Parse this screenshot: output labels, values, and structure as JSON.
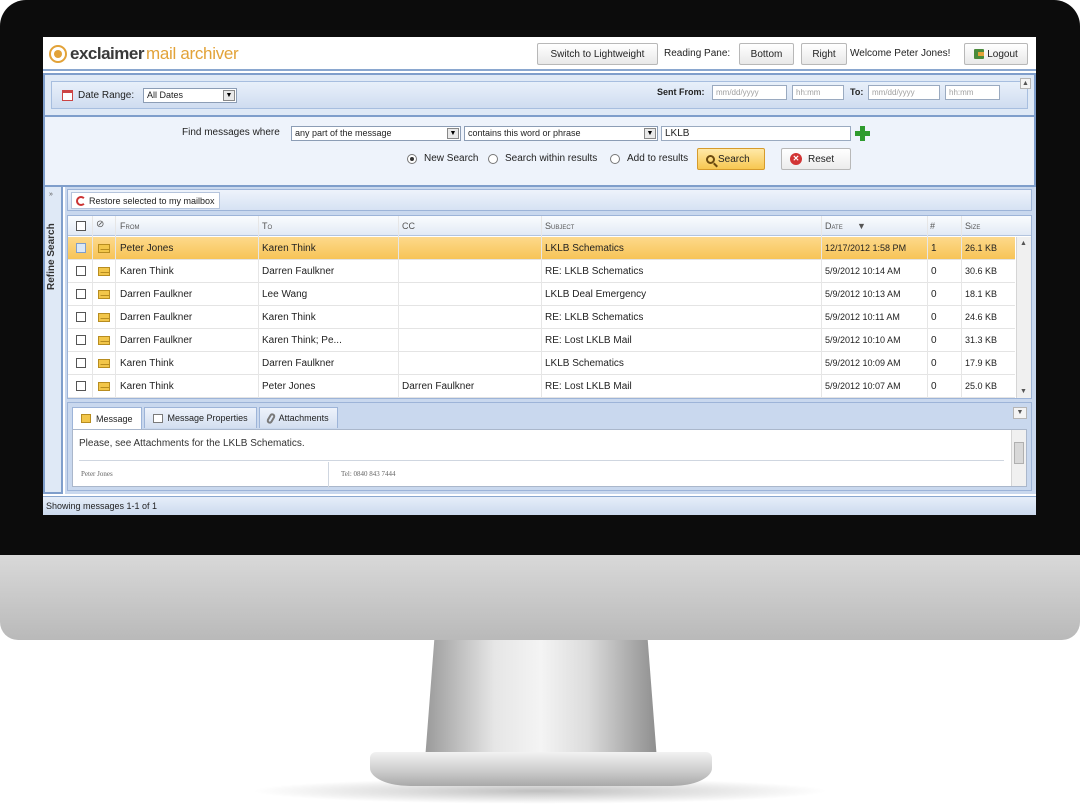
{
  "app": {
    "brand": "exclaimer",
    "product": "mail archiver"
  },
  "header": {
    "switch_label": "Switch to Lightweight",
    "reading_pane_label": "Reading Pane:",
    "bottom_label": "Bottom",
    "right_label": "Right",
    "welcome": "Welcome Peter Jones!",
    "logout_label": "Logout"
  },
  "filter": {
    "date_range_label": "Date Range:",
    "date_range_value": "All Dates",
    "sent_from_label": "Sent From:",
    "sent_from_date_placeholder": "mm/dd/yyyy",
    "sent_from_time_placeholder": "hh:mm",
    "to_label": "To:",
    "to_date_placeholder": "mm/dd/yyyy",
    "to_time_placeholder": "hh:mm"
  },
  "search": {
    "find_label": "Find messages where",
    "field_value": "any part of the message",
    "operator_value": "contains this word or phrase",
    "term_value": "LKLB",
    "radio_new": "New Search",
    "radio_within": "Search within results",
    "radio_add": "Add to results",
    "search_button": "Search",
    "reset_button": "Reset"
  },
  "sidebar": {
    "refine_label": "Refine Search"
  },
  "toolbar": {
    "restore_label": "Restore selected to my mailbox"
  },
  "grid": {
    "columns": {
      "from": "From",
      "to": "To",
      "cc": "CC",
      "subject": "Subject",
      "date": "Date",
      "count": "#",
      "size": "Size"
    },
    "rows": [
      {
        "from": "Peter Jones",
        "to": "Karen Think",
        "cc": "",
        "subject": "LKLB Schematics",
        "date": "12/17/2012 1:58 PM",
        "count": "1",
        "size": "26.1 KB"
      },
      {
        "from": "Karen Think",
        "to": "Darren Faulkner",
        "cc": "",
        "subject": "RE: LKLB Schematics",
        "date": "5/9/2012 10:14 AM",
        "count": "0",
        "size": "30.6 KB"
      },
      {
        "from": "Darren Faulkner",
        "to": "Lee Wang",
        "cc": "",
        "subject": "LKLB Deal Emergency",
        "date": "5/9/2012 10:13 AM",
        "count": "0",
        "size": "18.1 KB"
      },
      {
        "from": "Darren Faulkner",
        "to": "Karen Think",
        "cc": "",
        "subject": "RE: LKLB Schematics",
        "date": "5/9/2012 10:11 AM",
        "count": "0",
        "size": "24.6 KB"
      },
      {
        "from": "Darren Faulkner",
        "to": "Karen Think; Pe...",
        "cc": "",
        "subject": "RE: Lost LKLB Mail",
        "date": "5/9/2012 10:10 AM",
        "count": "0",
        "size": "31.3 KB"
      },
      {
        "from": "Karen Think",
        "to": "Darren Faulkner",
        "cc": "",
        "subject": "LKLB Schematics",
        "date": "5/9/2012 10:09 AM",
        "count": "0",
        "size": "17.9 KB"
      },
      {
        "from": "Karen Think",
        "to": "Peter Jones",
        "cc": "Darren Faulkner",
        "subject": "RE: Lost LKLB Mail",
        "date": "5/9/2012 10:07 AM",
        "count": "0",
        "size": "25.0 KB"
      }
    ]
  },
  "preview": {
    "tabs": [
      "Message",
      "Message Properties",
      "Attachments"
    ],
    "body_text": "Please, see Attachments for the LKLB Schematics.",
    "signature_name": "Peter Jones",
    "signature_phone": "Tel: 0840 843 7444"
  },
  "status": {
    "text": "Showing messages 1-1 of 1"
  },
  "colors": {
    "accent": "#e2a238",
    "frame_blue": "#7f9ecb",
    "selected_row": "#f7c457",
    "add_green": "#2e9b2e",
    "reset_red": "#d23434"
  },
  "icons": [
    "logo-icon",
    "logout-icon",
    "calendar-icon",
    "add-icon",
    "search-icon",
    "reset-icon",
    "restore-icon",
    "attachment-icon",
    "envelope-icon",
    "sort-desc-icon"
  ]
}
